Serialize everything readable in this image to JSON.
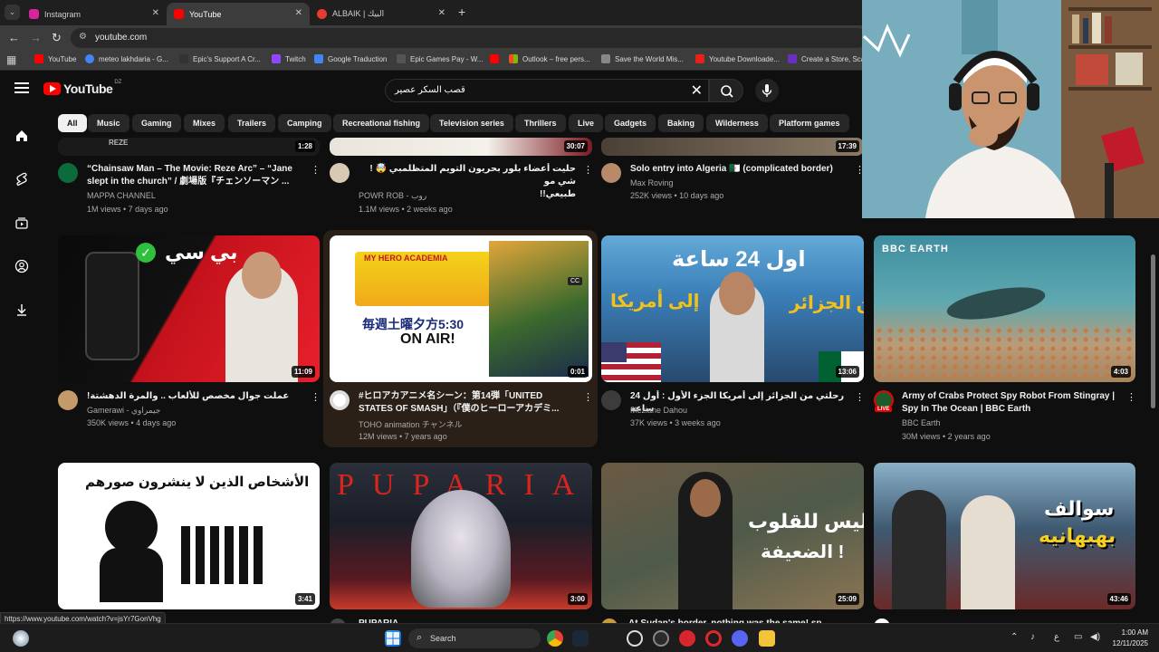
{
  "browser": {
    "tabs": [
      {
        "title": "Instagram",
        "favicon_color": "#d6249f"
      },
      {
        "title": "YouTube",
        "favicon_color": "#ff0000"
      },
      {
        "title": "ALBAIK | البيك",
        "favicon_color": "#e63b2e"
      }
    ],
    "close_glyph": "✕",
    "new_tab_glyph": "+",
    "url": "youtube.com",
    "bookmarks": [
      {
        "label": "YouTube",
        "color": "#ff0000"
      },
      {
        "label": "meteo lakhdaria - G...",
        "color": "#4285f4"
      },
      {
        "label": "Epic's Support A Cr...",
        "color": "#333333"
      },
      {
        "label": "Twitch",
        "color": "#9146ff"
      },
      {
        "label": "Google Traduction",
        "color": "#4285f4"
      },
      {
        "label": "Epic Games Pay - W...",
        "color": "#555555"
      },
      {
        "label": "",
        "color": "#ff0000"
      },
      {
        "label": "Outlook – free pers...",
        "color": "#0078d4"
      },
      {
        "label": "Save the World Mis...",
        "color": "#888888"
      },
      {
        "label": "Youtube Downloade...",
        "color": "#e62117"
      },
      {
        "label": "Create a Store, Scal",
        "color": "#6b2fbf"
      }
    ]
  },
  "youtube": {
    "logo_text": "YouTube",
    "country_code": "DZ",
    "search_query": "قصب السكر عصير",
    "chips": [
      "All",
      "Music",
      "Gaming",
      "Mixes",
      "Trailers",
      "Camping",
      "Recreational fishing",
      "Television series",
      "Thrillers",
      "Live",
      "Gadgets",
      "Baking",
      "Wilderness",
      "Platform games"
    ],
    "row1": [
      {
        "title1": "“Chainsaw Man – The Movie: Reze Arc” – “Jane",
        "title2": "slept in the church” / 劇場版『チェンソーマン ...",
        "channel": "MAPPA CHANNEL",
        "meta": "1M views • 7 days ago",
        "duration": "1:28",
        "thumb_text": "REZE"
      },
      {
        "title1": "حليت أعضاء بلور بحريون التويم المتظلمبي 🤯 ! شي مو",
        "title2": "طبيعي!!",
        "channel": "POWR ROB - روب",
        "meta": "1.1M views • 2 weeks ago",
        "duration": "30:07"
      },
      {
        "title1": "Solo entry into Algeria 🇩🇿 (complicated border)",
        "title2": "",
        "channel": "Max Roving",
        "meta": "252K views • 10 days ago",
        "duration": "17:39"
      }
    ],
    "row2": [
      {
        "title1": "عملت جوال مخصص للألعاب .. والمرة الدهشتة!",
        "title2": "",
        "channel": "Gamerawi - جيمراوي",
        "meta": "350K views • 4 days ago",
        "duration": "11:09",
        "thumb_text": "بي سي"
      },
      {
        "title1": "#ヒロアカアニメ名シーン：第14弾「UNITED",
        "title2": "STATES OF SMASH」（『僕のヒーローアカデミ...",
        "channel": "TOHO animation チャンネル",
        "meta": "12M views • 7 years ago",
        "duration": "0:01",
        "thumb_text": "MY HERO ACADEMIA",
        "thumb_sub": "ON AIR!",
        "thumb_sub2": "毎週土曜夕方5:30",
        "cc": "CC"
      },
      {
        "title1": "رحلتي من الجزائر إلى أمريكا الجزء الأول : أول 24 ساعة",
        "title2": "",
        "channel": "Meziane Dahou",
        "meta": "37K views • 3 weeks ago",
        "duration": "13:06",
        "thumb_text": "اول 24 ساعة",
        "thumb_sub": "من الجزائر",
        "thumb_sub2": "إلى أمريكا"
      },
      {
        "title1": "Army of Crabs Protect Spy Robot From Stingray |",
        "title2": "Spy In The Ocean | BBC Earth",
        "channel": "BBC Earth",
        "meta": "30M views • 2 years ago",
        "duration": "4:03",
        "thumb_text": "BBC EARTH",
        "live": "LIVE"
      }
    ],
    "row3": [
      {
        "duration": "3:41",
        "thumb_text": "الأشخاص الذين لا ينشرون صورهم",
        "title_peek": ""
      },
      {
        "duration": "3:00",
        "thumb_text": "PUPARIA",
        "title_peek": "PUPARIA"
      },
      {
        "duration": "25:09",
        "thumb_text": "ليس للقلوب",
        "thumb_sub": "الضعيفة !",
        "title_peek": "At Sudan's border, nothing was the same! sp..."
      },
      {
        "duration": "43:46",
        "thumb_text": "سوالف",
        "thumb_sub": "بهبهانيه",
        "title_peek": ""
      }
    ]
  },
  "status_url": "https://www.youtube.com/watch?v=jsYr7GonVhg",
  "taskbar": {
    "search_label": "Search",
    "lang": "ع",
    "time": "1:00 AM",
    "date": "12/11/2025"
  }
}
